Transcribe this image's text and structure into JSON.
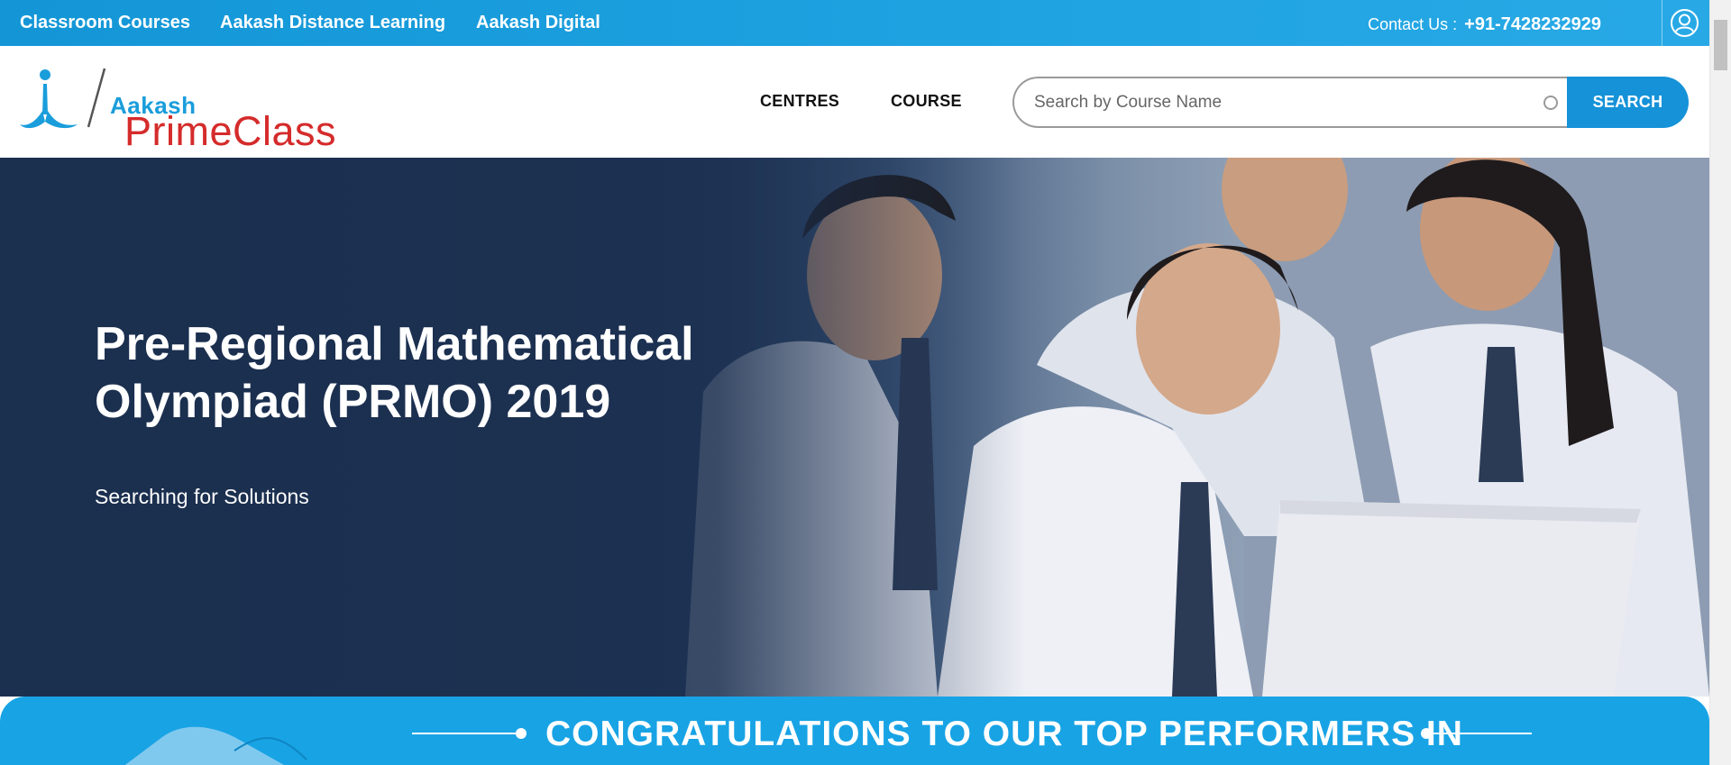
{
  "topbar": {
    "links": [
      "Classroom Courses",
      "Aakash Distance Learning",
      "Aakash Digital"
    ],
    "contact_label": "Contact Us :",
    "contact_phone": "+91-7428232929"
  },
  "logo": {
    "line1": "Aakash",
    "line2": "PrimeClass"
  },
  "nav": {
    "centres": "CENTRES",
    "course": "COURSE"
  },
  "search": {
    "placeholder": "Search by Course Name",
    "button_label": "SEARCH"
  },
  "hero": {
    "title": "Pre-Regional Mathematical Olympiad (PRMO) 2019",
    "subtitle": "Searching for Solutions"
  },
  "banner": {
    "text": "CONGRATULATIONS TO OUR TOP PERFORMERS IN"
  },
  "colors": {
    "topbar": "#1fa3e1",
    "brand_blue": "#1592d8",
    "brand_red": "#d52b2b",
    "hero_dark": "#1b2f4f",
    "banner": "#18a3e5"
  }
}
